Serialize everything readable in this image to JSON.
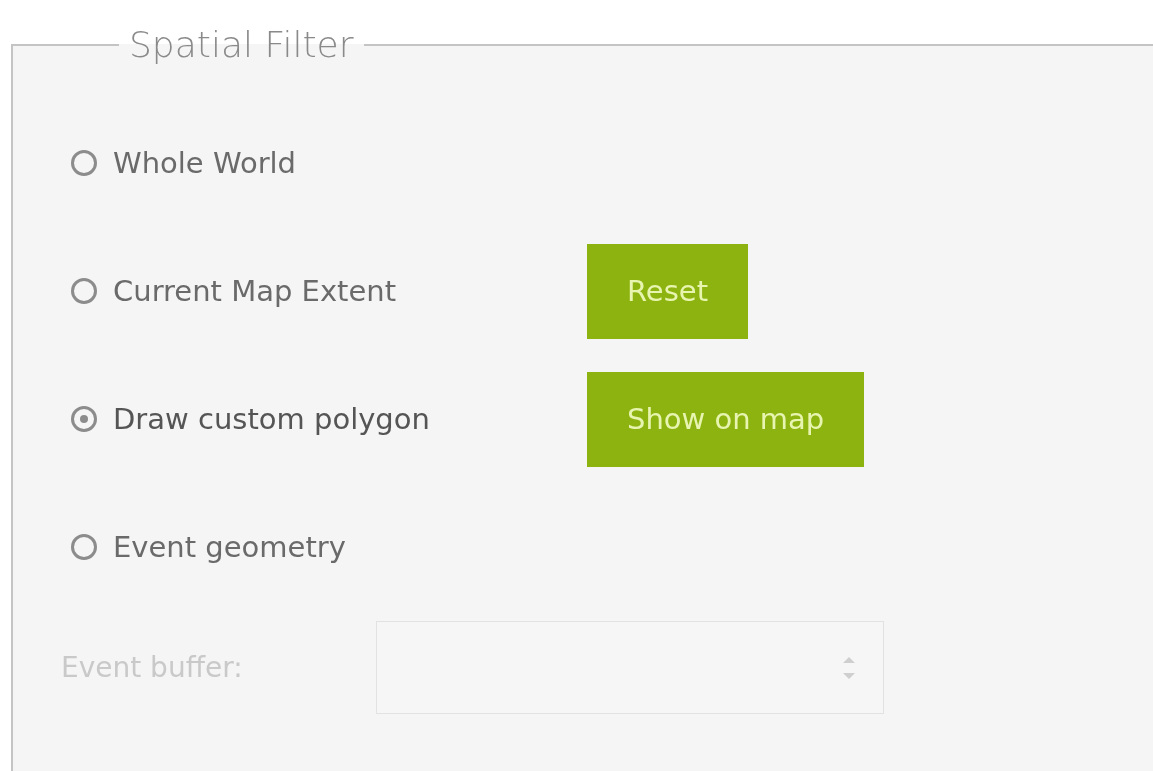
{
  "fieldset": {
    "legend": "Spatial Filter"
  },
  "options": [
    {
      "label": "Whole World",
      "selected": false
    },
    {
      "label": "Current Map Extent",
      "selected": false,
      "button": "Reset"
    },
    {
      "label": "Draw custom polygon",
      "selected": true,
      "button": "Show on map"
    },
    {
      "label": "Event geometry",
      "selected": false
    }
  ],
  "buffer": {
    "label": "Event buffer:",
    "disabled": true
  }
}
